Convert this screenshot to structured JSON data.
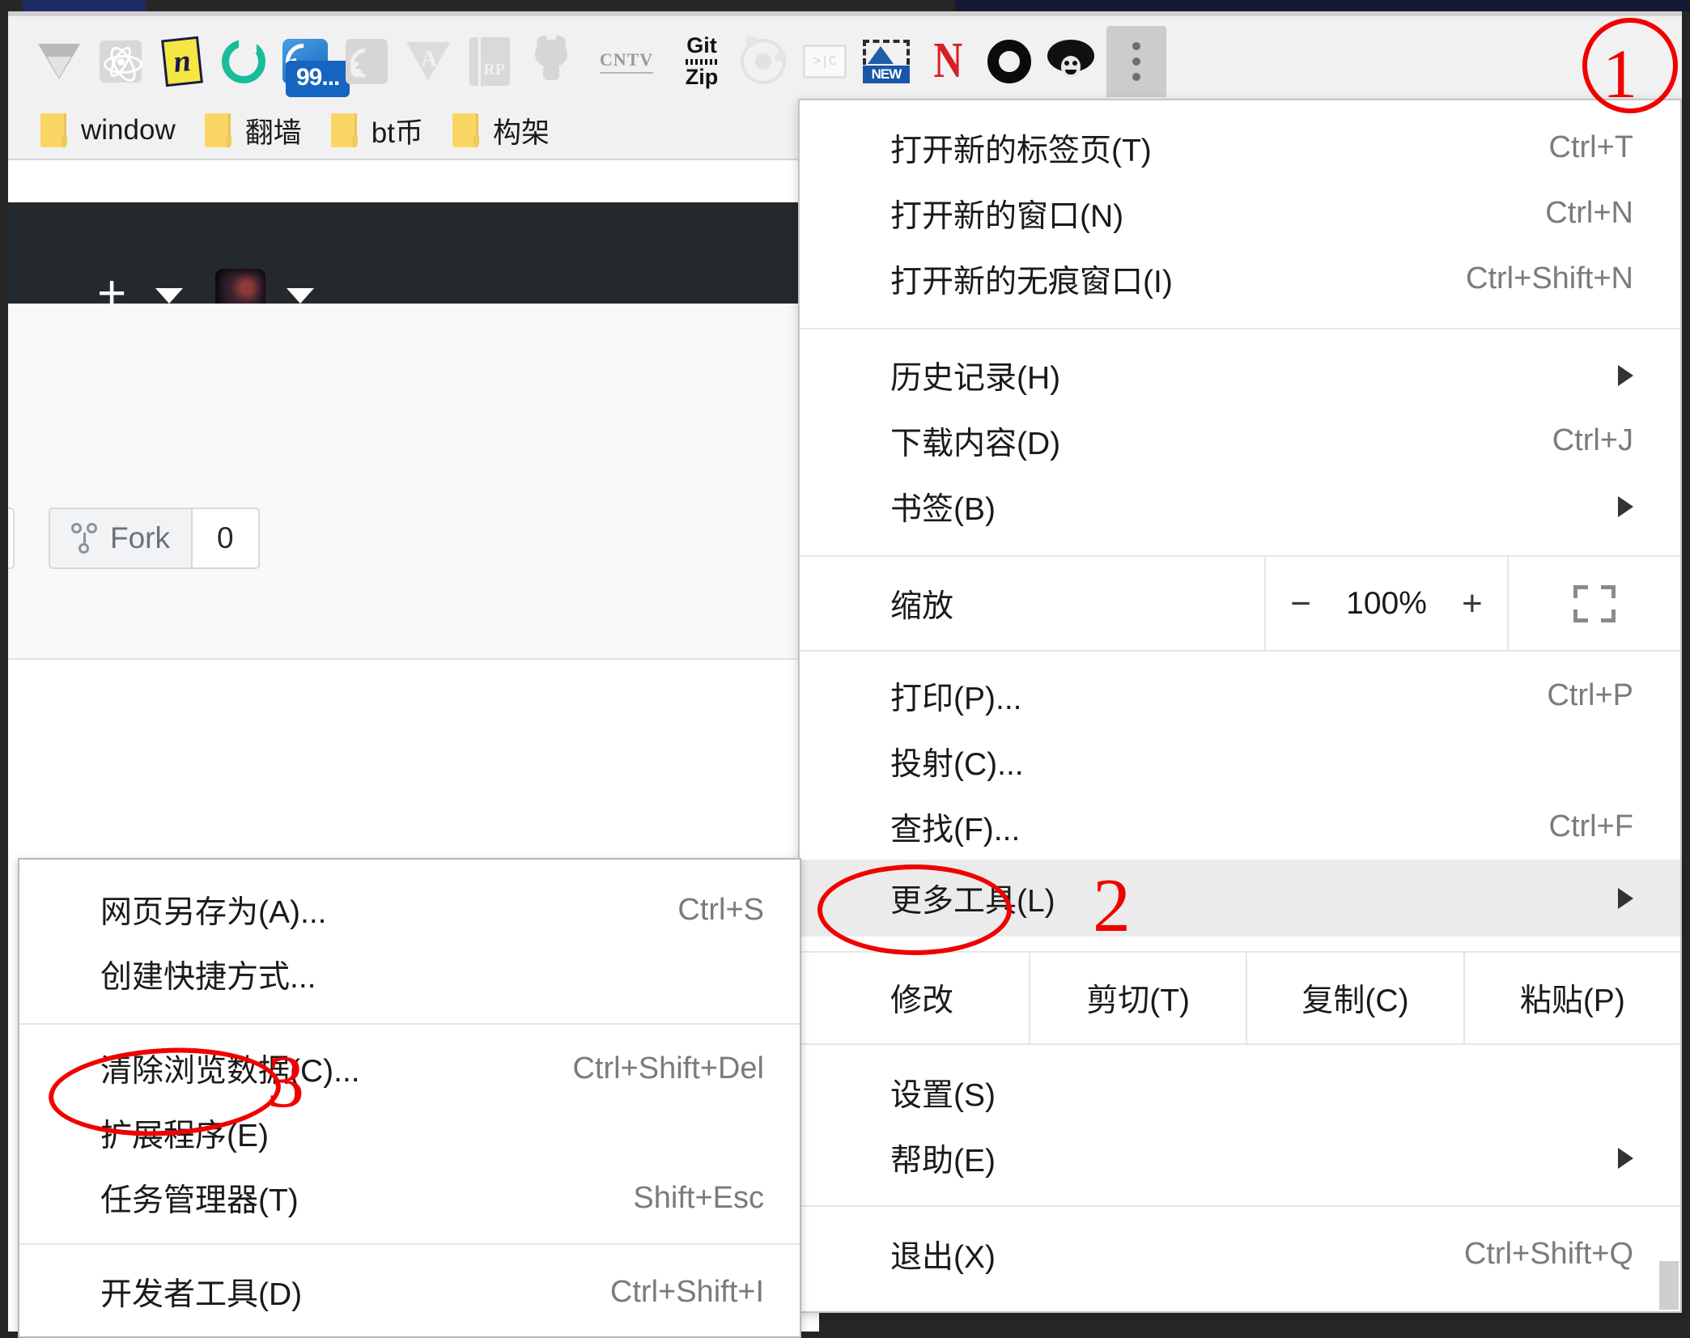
{
  "window": {
    "tab_strip_color": "#1e2b63"
  },
  "toolbar": {
    "extensions": [
      {
        "name": "vue-devtools-icon",
        "label": "Vue"
      },
      {
        "name": "react-devtools-icon",
        "label": "React"
      },
      {
        "name": "notes-icon",
        "label": "n"
      },
      {
        "name": "sync-icon",
        "label": "Sync"
      },
      {
        "name": "rss-reader-icon",
        "label": "RSS",
        "badge": "99..."
      },
      {
        "name": "rss-gray-icon",
        "label": "RSS"
      },
      {
        "name": "angular-icon",
        "label": "A"
      },
      {
        "name": "rp-icon",
        "label": "RP"
      },
      {
        "name": "octocat-icon",
        "label": "GitHub"
      },
      {
        "name": "cntv-icon",
        "label": "CNTV"
      },
      {
        "name": "gitzip-icon",
        "label_top": "Git",
        "label_bottom": "Zip"
      },
      {
        "name": "orbit-icon",
        "label": "Orbit"
      },
      {
        "name": "console-icon",
        "label": ">|C"
      },
      {
        "name": "new-tab-icon",
        "label": "NEW"
      },
      {
        "name": "netflix-icon",
        "label": "N"
      },
      {
        "name": "opera-icon",
        "label": "O"
      },
      {
        "name": "tampermonkey-icon",
        "label": "Monkey"
      }
    ],
    "menu_button": "chrome-menu-button"
  },
  "bookmarks": [
    {
      "label": "window"
    },
    {
      "label": "翻墙"
    },
    {
      "label": "bt币"
    },
    {
      "label": "构架"
    }
  ],
  "page": {
    "fork_label": "Fork",
    "fork_count": "0"
  },
  "main_menu": {
    "groups": [
      {
        "items": [
          {
            "label": "打开新的标签页(T)",
            "accel": "Ctrl+T",
            "arrow": false
          },
          {
            "label": "打开新的窗口(N)",
            "accel": "Ctrl+N",
            "arrow": false
          },
          {
            "label": "打开新的无痕窗口(I)",
            "accel": "Ctrl+Shift+N",
            "arrow": false
          }
        ]
      },
      {
        "items": [
          {
            "label": "历史记录(H)",
            "accel": "",
            "arrow": true
          },
          {
            "label": "下载内容(D)",
            "accel": "Ctrl+J",
            "arrow": false
          },
          {
            "label": "书签(B)",
            "accel": "",
            "arrow": true
          }
        ]
      },
      {
        "zoom": {
          "label": "缩放",
          "minus": "−",
          "value": "100%",
          "plus": "+",
          "fullscreen": "fullscreen-icon"
        }
      },
      {
        "items": [
          {
            "label": "打印(P)...",
            "accel": "Ctrl+P",
            "arrow": false
          },
          {
            "label": "投射(C)...",
            "accel": "",
            "arrow": false
          },
          {
            "label": "查找(F)...",
            "accel": "Ctrl+F",
            "arrow": false
          },
          {
            "label": "更多工具(L)",
            "accel": "",
            "arrow": true,
            "highlight": true
          }
        ]
      },
      {
        "edit_row": {
          "label": "修改",
          "cut": "剪切(T)",
          "copy": "复制(C)",
          "paste": "粘贴(P)"
        }
      },
      {
        "items": [
          {
            "label": "设置(S)",
            "accel": "",
            "arrow": false
          },
          {
            "label": "帮助(E)",
            "accel": "",
            "arrow": true
          }
        ]
      },
      {
        "items": [
          {
            "label": "退出(X)",
            "accel": "Ctrl+Shift+Q",
            "arrow": false
          }
        ]
      }
    ]
  },
  "sub_menu": {
    "groups": [
      {
        "items": [
          {
            "label": "网页另存为(A)...",
            "accel": "Ctrl+S"
          },
          {
            "label": "创建快捷方式...",
            "accel": ""
          }
        ]
      },
      {
        "items": [
          {
            "label": "清除浏览数据(C)...",
            "accel": "Ctrl+Shift+Del"
          },
          {
            "label": "扩展程序(E)",
            "accel": ""
          },
          {
            "label": "任务管理器(T)",
            "accel": "Shift+Esc"
          }
        ]
      },
      {
        "items": [
          {
            "label": "开发者工具(D)",
            "accel": "Ctrl+Shift+I"
          }
        ]
      }
    ]
  },
  "annotations": {
    "color": "#f10000",
    "step1": "1",
    "step2": "2",
    "step3": "3"
  }
}
